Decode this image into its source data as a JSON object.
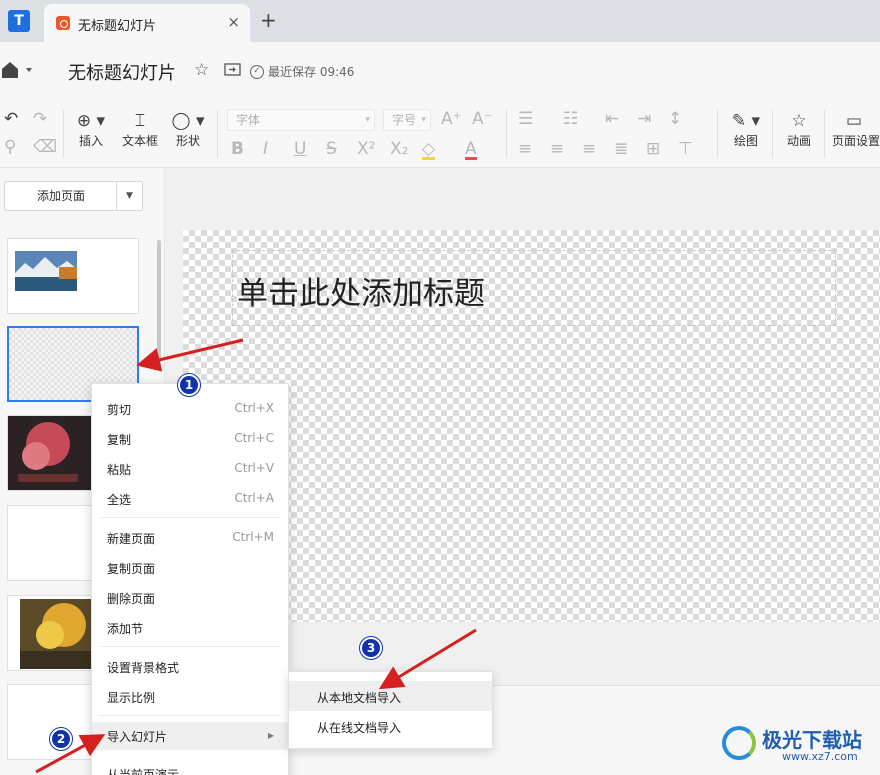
{
  "tab": {
    "title": "无标题幻灯片",
    "close": "×",
    "add": "+"
  },
  "header": {
    "doc_title": "无标题幻灯片",
    "save_status": "最近保存 09:46"
  },
  "toolbar": {
    "insert": "插入",
    "textbox": "文本框",
    "shape": "形状",
    "font_placeholder": "字体",
    "size_placeholder": "字号",
    "draw": "绘图",
    "animation": "动画",
    "page_setup": "页面设置"
  },
  "sidebar": {
    "add_page": "添加页面"
  },
  "slide": {
    "title_placeholder": "单击此处添加标题"
  },
  "context_menu": {
    "items": [
      {
        "label": "剪切",
        "shortcut": "Ctrl+X"
      },
      {
        "label": "复制",
        "shortcut": "Ctrl+C"
      },
      {
        "label": "粘贴",
        "shortcut": "Ctrl+V"
      },
      {
        "label": "全选",
        "shortcut": "Ctrl+A"
      },
      {
        "label": "新建页面",
        "shortcut": "Ctrl+M"
      },
      {
        "label": "复制页面",
        "shortcut": ""
      },
      {
        "label": "删除页面",
        "shortcut": ""
      },
      {
        "label": "添加节",
        "shortcut": ""
      },
      {
        "label": "设置背景格式",
        "shortcut": ""
      },
      {
        "label": "显示比例",
        "shortcut": ""
      },
      {
        "label": "导入幻灯片",
        "shortcut": "▸"
      },
      {
        "label": "从当前页演示",
        "shortcut": ""
      }
    ]
  },
  "submenu": {
    "items": [
      {
        "label": "从本地文档导入"
      },
      {
        "label": "从在线文档导入"
      }
    ]
  },
  "annotations": {
    "step1": "1",
    "step2": "2",
    "step3": "3"
  },
  "watermark": {
    "name": "极光下载站",
    "url": "www.xz7.com"
  },
  "colors": {
    "accent": "#2f7df6",
    "arrow": "#d6201f",
    "badge": "#1133aa"
  }
}
